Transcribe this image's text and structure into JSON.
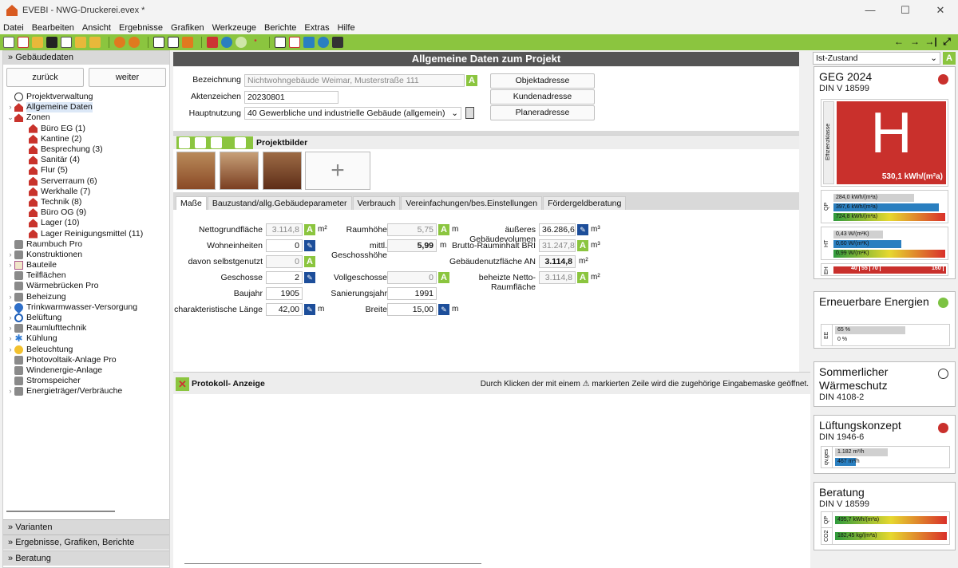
{
  "window": {
    "title": "EVEBI - NWG-Druckerei.evex *",
    "minimize": "—",
    "maximize": "☐",
    "close": "✕"
  },
  "menu": [
    "Datei",
    "Bearbeiten",
    "Ansicht",
    "Ergebnisse",
    "Grafiken",
    "Werkzeuge",
    "Berichte",
    "Extras",
    "Hilfe"
  ],
  "toolbar_right": [
    "←",
    "→",
    "→|",
    "⤢"
  ],
  "sidebar": {
    "header": "Gebäudedaten",
    "back": "zurück",
    "forward": "weiter",
    "tree": [
      {
        "label": "Projektverwaltung",
        "level": 0,
        "icon": "clock-icon",
        "arrow": ""
      },
      {
        "label": "Allgemeine Daten",
        "level": 0,
        "icon": "house-icon",
        "arrow": "›",
        "selected": true
      },
      {
        "label": "Zonen",
        "level": 0,
        "icon": "house-icon",
        "arrow": "⌄"
      },
      {
        "label": "Büro EG (1)",
        "level": 1,
        "icon": "house-icon",
        "arrow": ""
      },
      {
        "label": "Kantine (2)",
        "level": 1,
        "icon": "house-icon",
        "arrow": ""
      },
      {
        "label": "Besprechung (3)",
        "level": 1,
        "icon": "house-icon",
        "arrow": ""
      },
      {
        "label": "Sanitär (4)",
        "level": 1,
        "icon": "house-icon",
        "arrow": ""
      },
      {
        "label": "Flur (5)",
        "level": 1,
        "icon": "house-icon",
        "arrow": ""
      },
      {
        "label": "Serverraum (6)",
        "level": 1,
        "icon": "house-icon",
        "arrow": ""
      },
      {
        "label": "Werkhalle (7)",
        "level": 1,
        "icon": "house-icon",
        "arrow": ""
      },
      {
        "label": "Technik (8)",
        "level": 1,
        "icon": "house-icon",
        "arrow": ""
      },
      {
        "label": "Büro OG (9)",
        "level": 1,
        "icon": "house-icon",
        "arrow": ""
      },
      {
        "label": "Lager (10)",
        "level": 1,
        "icon": "house-icon",
        "arrow": ""
      },
      {
        "label": "Lager Reinigungsmittel (11)",
        "level": 1,
        "icon": "house-icon",
        "arrow": ""
      },
      {
        "label": "Raumbuch Pro",
        "level": 0,
        "icon": "generic-icon",
        "arrow": ""
      },
      {
        "label": "Konstruktionen",
        "level": 0,
        "icon": "generic-icon",
        "arrow": "›"
      },
      {
        "label": "Bauteile",
        "level": 0,
        "icon": "doc-icon",
        "arrow": "›"
      },
      {
        "label": "Teilflächen",
        "level": 0,
        "icon": "generic-icon",
        "arrow": ""
      },
      {
        "label": "Wärmebrücken Pro",
        "level": 0,
        "icon": "generic-icon",
        "arrow": ""
      },
      {
        "label": "Beheizung",
        "level": 0,
        "icon": "generic-icon",
        "arrow": "›"
      },
      {
        "label": "Trinkwarmwasser-Versorgung",
        "level": 0,
        "icon": "drop-icon",
        "arrow": "›"
      },
      {
        "label": "Belüftung",
        "level": 0,
        "icon": "fan-icon",
        "arrow": "›"
      },
      {
        "label": "Raumlufttechnik",
        "level": 0,
        "icon": "generic-icon",
        "arrow": "›"
      },
      {
        "label": "Kühlung",
        "level": 0,
        "icon": "snow-icon",
        "arrow": "›"
      },
      {
        "label": "Beleuchtung",
        "level": 0,
        "icon": "bulb-icon",
        "arrow": "›"
      },
      {
        "label": "Photovoltaik-Anlage Pro",
        "level": 0,
        "icon": "generic-icon",
        "arrow": ""
      },
      {
        "label": "Windenergie-Anlage",
        "level": 0,
        "icon": "generic-icon",
        "arrow": ""
      },
      {
        "label": "Stromspeicher",
        "level": 0,
        "icon": "generic-icon",
        "arrow": ""
      },
      {
        "label": "Energieträger/Verbräuche",
        "level": 0,
        "icon": "generic-icon",
        "arrow": "›"
      }
    ],
    "bottom": [
      "Varianten",
      "Ergebnisse, Grafiken, Berichte",
      "Beratung"
    ]
  },
  "main": {
    "title": "Allgemeine Daten zum Projekt",
    "bezeichnung_label": "Bezeichnung",
    "bezeichnung_value": "Nichtwohngebäude Weimar, Musterstraße 111",
    "aktenzeichen_label": "Aktenzeichen",
    "aktenzeichen_value": "20230801",
    "hauptnutzung_label": "Hauptnutzung",
    "hauptnutzung_value": "40 Gewerbliche und industrielle Gebäude (allgemein)",
    "address_buttons": [
      "Objektadresse",
      "Kundenadresse",
      "Planeradresse"
    ],
    "projektbilder": "Projektbilder",
    "tabs": [
      "Maße",
      "Bauzustand/allg.Gebäudeparameter",
      "Verbrauch",
      "Vereinfachungen/bes.Einstellungen",
      "Fördergeldberatung"
    ],
    "col1": [
      {
        "label": "Nettogrundfläche",
        "value": "3.114,8",
        "ro": true,
        "btn": "A",
        "unit": "m²"
      },
      {
        "label": "Wohneinheiten",
        "value": "0",
        "ro": false,
        "btn": "pen",
        "unit": ""
      },
      {
        "label": "davon selbstgenutzt",
        "value": "0",
        "ro": true,
        "btn": "A",
        "unit": ""
      },
      {
        "label": "Geschosse",
        "value": "2",
        "ro": false,
        "btn": "pen",
        "unit": ""
      },
      {
        "label": "Baujahr",
        "value": "1905",
        "ro": false,
        "btn": "",
        "unit": ""
      },
      {
        "label": "charakteristische Länge",
        "value": "42,00",
        "ro": false,
        "btn": "pen",
        "unit": "m"
      }
    ],
    "col2": [
      {
        "label": "Raumhöhe",
        "value": "5,75",
        "ro": true,
        "btn": "A",
        "unit": "m"
      },
      {
        "label": "mittl. Geschosshöhe",
        "value": "5,99",
        "ro": true,
        "bold": true,
        "btn": "",
        "unit": "m"
      },
      {
        "label": "",
        "value": "",
        "btn": "",
        "unit": ""
      },
      {
        "label": "Vollgeschosse",
        "value": "0",
        "ro": true,
        "btn": "A",
        "unit": ""
      },
      {
        "label": "Sanierungsjahr",
        "value": "1991",
        "ro": false,
        "btn": "",
        "unit": ""
      },
      {
        "label": "Breite",
        "value": "15,00",
        "ro": false,
        "btn": "pen",
        "unit": "m"
      }
    ],
    "col3": [
      {
        "label": "äußeres Gebäudevolumen",
        "value": "36.286,6",
        "ro": false,
        "btn": "pen",
        "unit": "m³"
      },
      {
        "label": "Brutto-Rauminhalt BRI",
        "value": "31.247,8",
        "ro": true,
        "btn": "A",
        "unit": "m³"
      },
      {
        "label": "Gebäudenutzfläche AN",
        "value": "3.114,8",
        "ro": true,
        "bold": true,
        "btn": "",
        "unit": "m²"
      },
      {
        "label": "beheizte Netto-Raumfläche",
        "value": "3.114,8",
        "ro": true,
        "btn": "A",
        "unit": "m²"
      }
    ],
    "protokoll_title": "Protokoll- Anzeige",
    "protokoll_hint": "Durch Klicken der mit einem ⚠ markierten Zeile wird die zugehörige Eingabemaske geöffnet."
  },
  "right": {
    "variant": "Ist-Zustand",
    "cards": [
      {
        "title": "GEG 2024",
        "sub": "DIN V 18599",
        "dot": "#c9302c",
        "class_letter": "H",
        "class_value": "530,1 kWh/(m²a)",
        "class_axis": "Effizienzklasse",
        "bars": [
          {
            "group": "QP",
            "items": [
              {
                "label": "284,0 kWh/(m²a)",
                "color": "#d0d0d0",
                "frac": 0.72
              },
              {
                "label": "397,6 kWh/(m²a)",
                "color": "#2a7fc0",
                "frac": 0.94
              },
              {
                "label": "724,8 kWh/(m²a)",
                "color": "grad",
                "frac": 1.0
              }
            ]
          },
          {
            "group": "HT",
            "items": [
              {
                "label": "0,43 W/(m²K)",
                "color": "#d0d0d0",
                "frac": 0.44
              },
              {
                "label": "0,60 W/(m²K)",
                "color": "#2a7fc0",
                "frac": 0.61
              },
              {
                "label": "0,99 W/(m²K)",
                "color": "grad",
                "frac": 1.0
              }
            ]
          }
        ],
        "eh_label": "EH",
        "eh_ticks": [
          "40",
          "55",
          "70",
          "160"
        ]
      },
      {
        "title": "Erneuerbare Energien",
        "sub": "",
        "dot": "#7cc242",
        "group": "EE",
        "bars": [
          "65 %",
          "0 %"
        ]
      },
      {
        "title": "Sommerlicher Wärmeschutz",
        "sub": "DIN 4108-2",
        "dot": "#ffffff"
      },
      {
        "title": "Lüftungskonzept",
        "sub": "DIN 1946-6",
        "dot": "#c9302c",
        "group": "qv,ges",
        "bars": [
          "1.182 m³/h",
          "467 m³/h"
        ]
      },
      {
        "title": "Beratung",
        "sub": "DIN V 18599",
        "dot": "",
        "bars": [
          {
            "group": "QP",
            "label": "495,7 kWh/(m²a)"
          },
          {
            "group": "CO2",
            "label": "182,45 kg/(m²a)"
          }
        ]
      }
    ]
  },
  "colors": {
    "accent": "#8bc53f",
    "title_bar": "#555555",
    "class_red": "#c9302c",
    "blue": "#2a7fc0"
  }
}
